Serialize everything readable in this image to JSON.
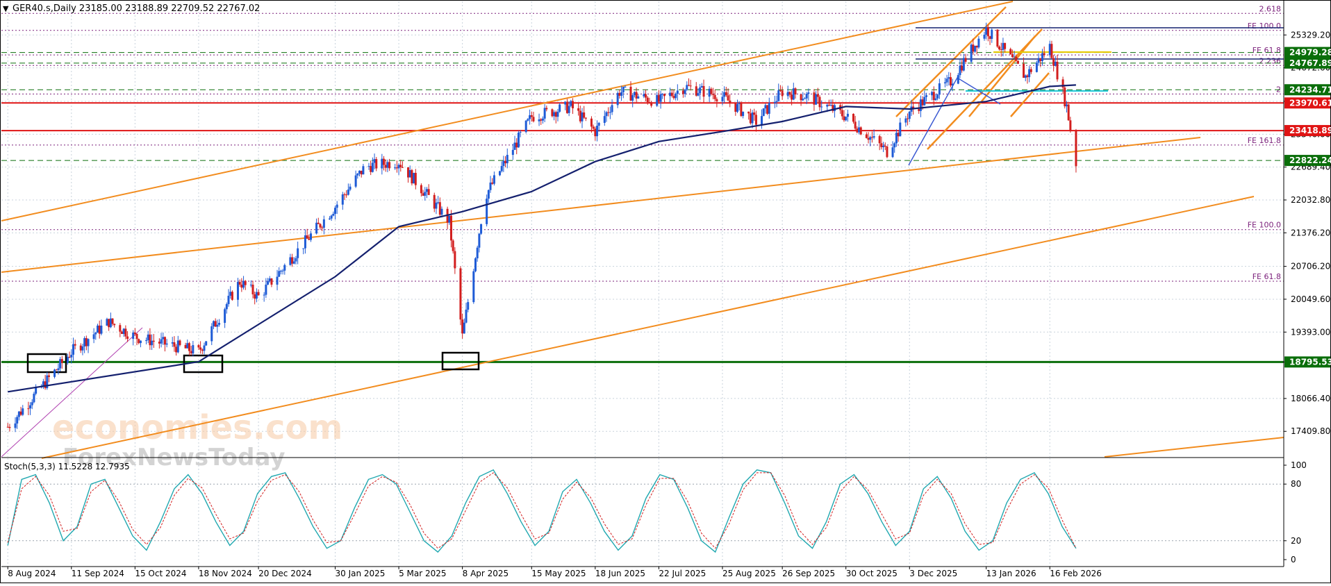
{
  "header": {
    "menu_arrow": "▼",
    "symbol_info": "GER40.s,Daily  23185.00 23188.89 22709.52 22767.02",
    "stoch_label": "Stoch(5,3,3) 11.5228 12.7935"
  },
  "watermark": {
    "line1": "economies.com",
    "line2": "ForexNewsToday"
  },
  "colors": {
    "candle_up": "#1e5bd6",
    "candle_down": "#d21e1e",
    "ma": "#14206e",
    "channel": "#f28c1e",
    "support": "#0a6e0a",
    "resistance": "#e01414",
    "fib": "#7a1e7a",
    "stoch_main": "#20a8b0",
    "stoch_signal": "#d21e1e"
  },
  "chart_data": [
    {
      "type": "candlestick",
      "symbol": "GER40.s",
      "timeframe": "Daily",
      "ohlc_last": {
        "open": 23185.0,
        "high": 23188.89,
        "low": 22709.52,
        "close": 22767.02
      },
      "ylim": [
        16900,
        26000
      ],
      "y_ticks": [
        17409.8,
        18066.4,
        18795.53,
        19393.0,
        20049.6,
        20706.2,
        21376.2,
        22032.8,
        22689.4,
        23346.0,
        24002.6,
        24672.6,
        25329.2
      ],
      "x_labels": [
        "8 Aug 2024",
        "11 Sep 2024",
        "15 Oct 2024",
        "18 Nov 2024",
        "20 Dec 2024",
        "30 Jan 2025",
        "5 Mar 2025",
        "8 Apr 2025",
        "15 May 2025",
        "18 Jun 2025",
        "22 Jul 2025",
        "25 Aug 2025",
        "26 Sep 2025",
        "30 Oct 2025",
        "3 Dec 2025",
        "13 Jan 2026",
        "16 Feb 2026"
      ],
      "price_series": {
        "name": "",
        "x": [
          "8 Aug 2024",
          "11 Sep 2024",
          "1 Oct 2024",
          "15 Oct 2024",
          "18 Nov 2024",
          "10 Dec 2024",
          "20 Dec 2024",
          "30 Jan 2025",
          "15 Feb 2025",
          "5 Mar 2025",
          "1 Apr 2025",
          "8 Apr 2025",
          "20 Apr 2025",
          "15 May 2025",
          "5 Jun 2025",
          "18 Jun 2025",
          "1 Jul 2025",
          "22 Jul 2025",
          "5 Aug 2025",
          "25 Aug 2025",
          "12 Sep 2025",
          "26 Sep 2025",
          "10 Oct 2025",
          "30 Oct 2025",
          "21 Nov 2025",
          "3 Dec 2025",
          "25 Dec 2025",
          "8 Jan 2026",
          "13 Jan 2026",
          "3 Feb 2026",
          "16 Feb 2026",
          "25 Feb 2026",
          "2 Mar 2026"
        ],
        "values": [
          17500,
          19000,
          19600,
          19300,
          19000,
          20400,
          20100,
          21900,
          22700,
          22800,
          21600,
          19300,
          22100,
          23700,
          23900,
          23400,
          24200,
          24000,
          24300,
          24100,
          23600,
          24200,
          24100,
          23700,
          23000,
          23800,
          24400,
          25200,
          25450,
          24500,
          25100,
          23900,
          22767
        ]
      },
      "moving_average": {
        "name": "",
        "x": [
          "8 Aug 2024",
          "18 Nov 2024",
          "30 Jan 2025",
          "5 Mar 2025",
          "8 Apr 2025",
          "15 May 2025",
          "18 Jun 2025",
          "22 Jul 2025",
          "25 Aug 2025",
          "26 Sep 2025",
          "30 Oct 2025",
          "3 Dec 2025",
          "13 Jan 2026",
          "16 Feb 2026",
          "2 Mar 2026"
        ],
        "values": [
          18200,
          18800,
          20500,
          21500,
          21800,
          22200,
          22800,
          23200,
          23400,
          23600,
          23900,
          23850,
          24000,
          24300,
          24330
        ]
      },
      "horizontal_levels": [
        {
          "label": "24979.28",
          "value": 24979.28,
          "kind": "support"
        },
        {
          "label": "24767.89",
          "value": 24767.89,
          "kind": "support"
        },
        {
          "label": "24234.71",
          "value": 24234.71,
          "kind": "support"
        },
        {
          "label": "23970.61",
          "value": 23970.61,
          "kind": "resistance"
        },
        {
          "label": "23418.89",
          "value": 23418.89,
          "kind": "resistance"
        },
        {
          "label": "22822.24",
          "value": 22822.24,
          "kind": "support"
        },
        {
          "label": "18795.53",
          "value": 18795.53,
          "kind": "support-major"
        }
      ],
      "fibonacci_levels": [
        {
          "label": "2.618",
          "value": 25760
        },
        {
          "label": "FE 100.0",
          "value": 25420
        },
        {
          "label": "FE 61.8",
          "value": 24930
        },
        {
          "label": "2.236",
          "value": 24720
        },
        {
          "label": "2",
          "value": 24150
        },
        {
          "label": "FE 161.8",
          "value": 23130
        },
        {
          "label": "FE 100.0",
          "value": 21440
        },
        {
          "label": "FE 61.8",
          "value": 20410
        }
      ]
    },
    {
      "type": "line",
      "name": "Stoch(5,3,3)",
      "ylim": [
        0,
        100
      ],
      "y_ticks": [
        0,
        20,
        80,
        100
      ],
      "series": [
        {
          "name": "",
          "values": [
            15,
            85,
            90,
            60,
            20,
            35,
            80,
            85,
            55,
            25,
            10,
            40,
            75,
            90,
            70,
            40,
            15,
            30,
            70,
            88,
            92,
            65,
            35,
            12,
            20,
            55,
            85,
            90,
            80,
            50,
            20,
            8,
            25,
            60,
            88,
            95,
            70,
            40,
            15,
            30,
            72,
            85,
            60,
            30,
            10,
            25,
            65,
            90,
            85,
            55,
            20,
            8,
            45,
            80,
            95,
            92,
            60,
            25,
            12,
            40,
            80,
            90,
            70,
            40,
            15,
            30,
            75,
            88,
            65,
            30,
            10,
            20,
            60,
            85,
            92,
            70,
            35,
            12
          ]
        },
        {
          "name": "",
          "values": [
            18,
            75,
            88,
            68,
            30,
            33,
            72,
            84,
            62,
            32,
            16,
            34,
            68,
            86,
            76,
            48,
            22,
            28,
            62,
            84,
            90,
            72,
            42,
            18,
            20,
            48,
            78,
            88,
            82,
            58,
            28,
            12,
            22,
            52,
            82,
            92,
            76,
            48,
            22,
            28,
            64,
            82,
            66,
            38,
            16,
            22,
            58,
            86,
            86,
            62,
            28,
            12,
            38,
            74,
            92,
            92,
            68,
            32,
            16,
            34,
            72,
            88,
            74,
            48,
            22,
            28,
            68,
            85,
            70,
            38,
            16,
            18,
            52,
            80,
            90,
            76,
            42,
            12
          ]
        }
      ]
    }
  ]
}
